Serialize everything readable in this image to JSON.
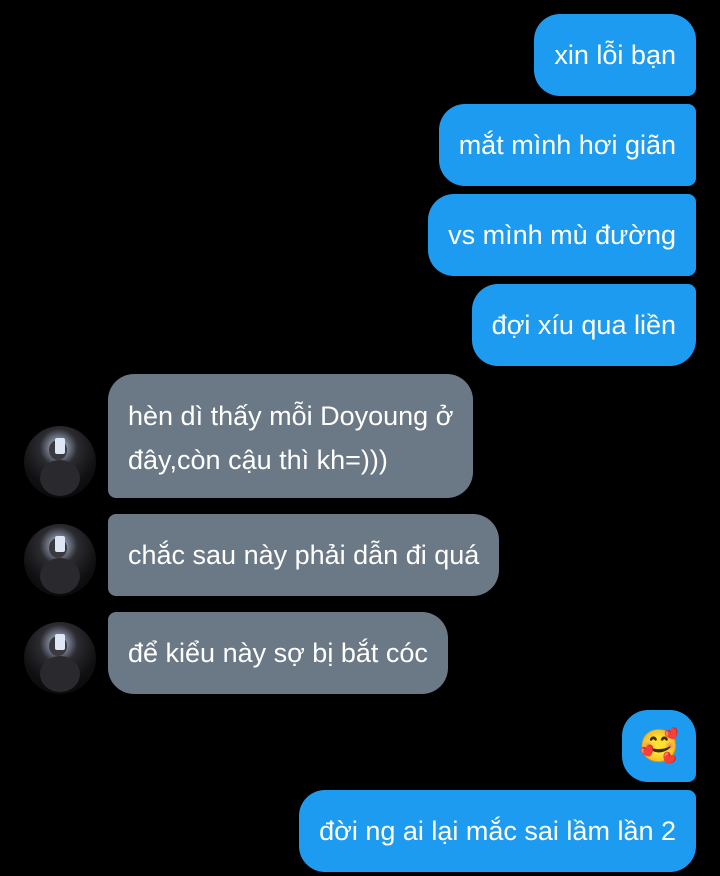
{
  "app": {
    "name": "chat-screen",
    "accent_color": "#1d9bf0",
    "incoming_color": "#6b7885",
    "background_color": "#000000"
  },
  "messages": [
    {
      "direction": "outgoing",
      "text": "xin lỗi bạn"
    },
    {
      "direction": "outgoing",
      "text": "mắt mình hơi giãn"
    },
    {
      "direction": "outgoing",
      "text": "vs mình mù đường"
    },
    {
      "direction": "outgoing",
      "text": "đợi xíu qua liền"
    },
    {
      "direction": "incoming",
      "lines": [
        "hèn dì thấy mỗi Doyoung ở",
        "đây,còn cậu thì kh=)))"
      ],
      "avatar_icon": "contact-avatar"
    },
    {
      "direction": "incoming",
      "text": "chắc sau này phải dẫn đi quá",
      "avatar_icon": "contact-avatar"
    },
    {
      "direction": "incoming",
      "text": "để kiểu này sợ bị bắt cóc",
      "avatar_icon": "contact-avatar"
    },
    {
      "direction": "outgoing",
      "emoji": "🥰",
      "emoji_name": "smiling-face-with-hearts-icon"
    },
    {
      "direction": "outgoing",
      "text": "đời ng ai lại mắc sai lầm lần 2"
    }
  ]
}
